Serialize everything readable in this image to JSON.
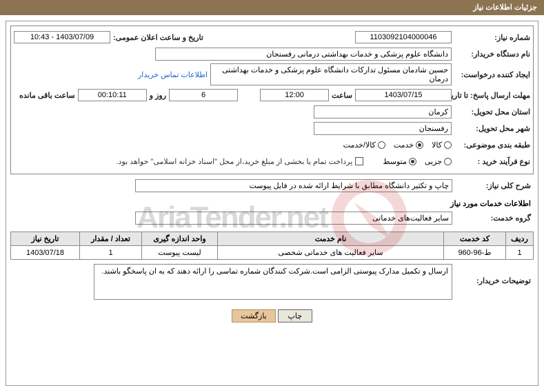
{
  "page_title": "جزئیات اطلاعات نیاز",
  "labels": {
    "need_number": "شماره نیاز:",
    "announce_datetime": "تاریخ و ساعت اعلان عمومی:",
    "buyer_org": "نام دستگاه خریدار:",
    "requester": "ایجاد کننده درخواست:",
    "buyer_contact": "اطلاعات تماس خریدار",
    "response_deadline": "مهلت ارسال پاسخ: تا تاریخ:",
    "time_word": "ساعت",
    "days_and": "روز و",
    "time_remaining": "ساعت باقی مانده",
    "delivery_province": "استان محل تحویل:",
    "delivery_city": "شهر محل تحویل:",
    "category": "طبقه بندی موضوعی:",
    "purchase_process": "نوع فرآیند خرید :",
    "treasury_note": "پرداخت تمام یا بخشی از مبلغ خرید،از محل \"اسناد خزانه اسلامی\" خواهد بود.",
    "general_desc": "شرح کلی نیاز:",
    "needed_services": "اطلاعات خدمات مورد نیاز",
    "service_group": "گروه خدمت:",
    "buyer_notes": "توضیحات خریدار:",
    "print": "چاپ",
    "back": "بازگشت"
  },
  "values": {
    "need_number": "1103092104000046",
    "announce_datetime": "1403/07/09 - 10:43",
    "buyer_org": "دانشگاه علوم پزشکی و خدمات بهداشتی درمانی رفسنجان",
    "requester": "حسین شادمان مسئول تدارکات دانشگاه علوم پزشکی و خدمات بهداشتی درمان",
    "deadline_date": "1403/07/15",
    "deadline_time": "12:00",
    "days_left": "6",
    "time_left": "00:10:11",
    "delivery_province": "کرمان",
    "delivery_city": "رفسنجان",
    "cat_goods": "کالا",
    "cat_service": "خدمت",
    "cat_goods_service": "کالا/خدمت",
    "proc_partial": "جزیی",
    "proc_medium": "متوسط",
    "general_desc": "چاپ و تکثیر دانشگاه مطابق با شرایط ارائه شده در فایل پیوست",
    "service_group": "سایر فعالیت‌های خدماتی",
    "buyer_notes": "ارسال و تکمیل مدارک پیوستی الزامی است.شرکت کنندگان شماره تماسی را ارائه دهند که به ان پاسخگو باشند."
  },
  "table": {
    "headers": {
      "row": "ردیف",
      "service_code": "کد خدمت",
      "service_name": "نام خدمت",
      "unit": "واحد اندازه گیری",
      "qty": "تعداد / مقدار",
      "need_date": "تاریخ نیاز"
    },
    "rows": [
      {
        "row": "1",
        "service_code": "ط-96-960",
        "service_name": "سایر فعالیت های خدماتی شخصی",
        "unit": "لیست پیوست",
        "qty": "1",
        "need_date": "1403/07/18"
      }
    ]
  },
  "watermark": "AriaTender.net"
}
